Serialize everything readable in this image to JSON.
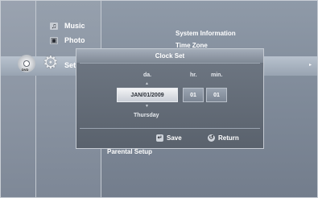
{
  "sidebar": {
    "items": [
      {
        "label": "Music",
        "icon": "music-note-icon"
      },
      {
        "label": "Photo",
        "icon": "photo-icon"
      },
      {
        "label": "Set",
        "icon": "gear-icon"
      }
    ]
  },
  "disc": {
    "label": "DVD"
  },
  "submenu": {
    "top_items": [
      "System Information",
      "Time Zone"
    ],
    "bottom_item": "Parental Setup",
    "arrow": "▸"
  },
  "dialog": {
    "title": "Clock Set",
    "columns": {
      "date": "da.",
      "hour": "hr.",
      "minute": "min."
    },
    "date_value": "JAN/01/2009",
    "hour_value": "01",
    "minute_value": "01",
    "weekday": "Thursday",
    "up_arrow": "▲",
    "down_arrow": "▼",
    "save_label": "Save",
    "return_label": "Return",
    "save_icon": "↵",
    "return_icon": "↺"
  }
}
